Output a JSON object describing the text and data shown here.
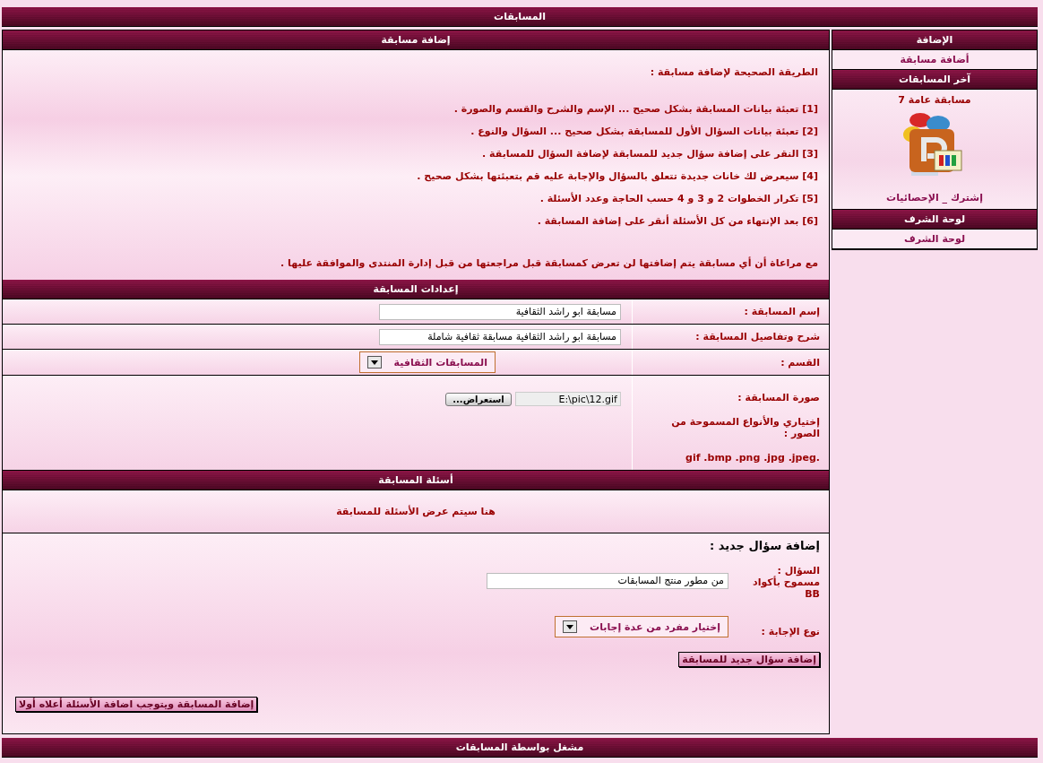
{
  "header": {
    "title": "المسابقات"
  },
  "sidebar": [
    {
      "title": "الإضافة",
      "kind": "links",
      "items": [
        "أضافة مسابقة"
      ]
    },
    {
      "title": "آخر المسابقات",
      "kind": "latest",
      "name": "مسابقة عامة 7",
      "link": "إشترك _ الإحصائيات"
    },
    {
      "title": "لوحة الشرف",
      "kind": "links",
      "items": [
        "لوحة الشرف"
      ]
    }
  ],
  "add_section": {
    "title": "إضافة مسابقة",
    "intro": "الطريقة الصحيحة لإضافة مسابقة :",
    "steps": [
      "[1] تعبئة بيانات المسابقة بشكل صحيح ... الإسم والشرح والقسم والصورة .",
      "[2] تعبئة بيانات السؤال الأول للمسابقة بشكل صحيح ... السؤال والنوع .",
      "[3] النقر على إضافة سؤال جديد للمسابقة لإضافة السؤال للمسابقة .",
      "[4] سيعرض لك خانات جديدة تتعلق بالسؤال والإجابة عليه قم بتعبئتها بشكل صحيح .",
      "[5] تكرار الخطوات 2 و 3 و 4 حسب الحاجة وعدد الأسئلة .",
      "[6] بعد الإنتهاء من كل الأسئلة أنقر على إضافة المسابقة ."
    ],
    "note": "مع مراعاة أن أي مسابقة يتم إضافتها لن تعرض كمسابقة قبل مراجعتها من قبل إدارة المنتدى والموافقة عليها ."
  },
  "settings": {
    "title": "إعدادات المسابقة",
    "fields": [
      {
        "kind": "text",
        "label": "إسم المسابقة :",
        "value": "مسابقة ابو راشد الثقافية"
      },
      {
        "kind": "text",
        "label": "شرح وتفاصيل المسابقة :",
        "value": "مسابقة ابو راشد الثقافية مسابقة ثقافية شاملة"
      },
      {
        "kind": "select",
        "label": "القسم :",
        "value": "المسابقات الثقافية"
      },
      {
        "kind": "file",
        "label": "صورة المسابقة :",
        "hint": "إختياري والأنواع المسموحة من الصور :",
        "formats": "gif .bmp .png .jpg .jpeg.",
        "value": "E:\\pic\\12.gif",
        "button": "استعراض..."
      }
    ]
  },
  "questions": {
    "title": "أسئلة المسابقة",
    "empty_text": "هنا سيتم عرض الأسئلة للمسابقة",
    "new_question": {
      "heading": "إضافة سؤال جديد :",
      "question_label": "السؤال :",
      "bb_note": "مسموح بأكواد BB",
      "question_value": "من مطور منتج المسابقات",
      "answer_label": "نوع الإجابة :",
      "answer_type": "إختيار مفرد من عدة إجابات",
      "add_button": "إضافة سؤال جديد للمسابقة"
    },
    "submit_button": "إضافة المسابقة ويتوجب اضافة الأسئلة أعلاه أولا"
  },
  "footer": {
    "text": "مشغل بواسطة المسابقات"
  }
}
